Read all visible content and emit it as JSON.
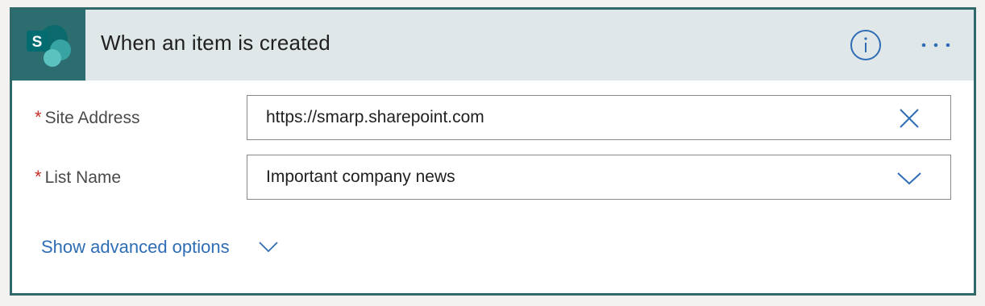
{
  "trigger": {
    "title": "When an item is created",
    "logo_letter": "S",
    "colors": {
      "border": "#31696a",
      "header_bg": "#dfe7e8",
      "logo_bg": "#2c6e70",
      "accent": "#2f6db5",
      "required": "#c4312b"
    }
  },
  "fields": [
    {
      "required_mark": "*",
      "label": "Site Address",
      "value": "https://smarp.sharepoint.com",
      "icon": "clear-icon"
    },
    {
      "required_mark": "*",
      "label": "List Name",
      "value": "Important company news",
      "icon": "chevron-down-icon"
    }
  ],
  "advanced": {
    "label": "Show advanced options",
    "icon": "chevron-down-icon"
  }
}
